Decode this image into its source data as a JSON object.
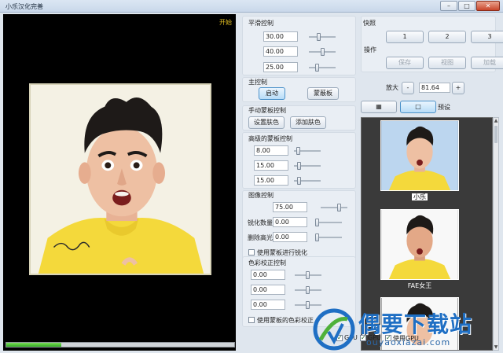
{
  "window": {
    "title": "小乐汉化完善",
    "min_label": "–",
    "max_label": "□",
    "close_label": "✕"
  },
  "viewer": {
    "start_label": "开始",
    "progress": 0.24
  },
  "smoothing": {
    "title": "平滑控制",
    "values": [
      "30.00",
      "40.00",
      "25.00"
    ],
    "slider_levels": [
      0.35,
      0.55,
      0.3
    ]
  },
  "main_control": {
    "title": "主控制",
    "start_label": "启动",
    "mask_label": "蒙蔽板"
  },
  "manual_mask": {
    "title": "手动蒙板控制",
    "set_color_label": "设置肤色",
    "add_color_label": "添加肤色"
  },
  "advanced_mask": {
    "title": "高级的蒙板控制",
    "values": [
      "8.00",
      "15.00",
      "15.00"
    ],
    "slider_levels": [
      0.1,
      0.15,
      0.15
    ]
  },
  "image_control": {
    "title": "图像控制",
    "row1_value": "75.00",
    "sharpen_label": "锐化数量",
    "sharpen_value": "0.00",
    "remove_highlight_label": "删除高光",
    "remove_highlight_value": "0.00",
    "use_mask_sharpen_label": "使用蒙板进行锐化",
    "slider_levels": [
      0.75,
      0.0,
      0.0
    ]
  },
  "color_correction": {
    "title": "色彩校正控制",
    "values": [
      "0.00",
      "0.00",
      "0.00"
    ],
    "slider_levels": [
      0.5,
      0.5,
      0.5
    ],
    "use_mask_label": "使用蒙板的色彩校正"
  },
  "snapshot": {
    "title": "快照",
    "buttons": [
      "1",
      "2",
      "3"
    ]
  },
  "operations": {
    "title": "操作",
    "save_label": "保存",
    "view_label": "视图",
    "load_label": "加载"
  },
  "zoom": {
    "label": "放大",
    "minus": "-",
    "value": "81.64",
    "plus": "+"
  },
  "view_mode": {
    "preset_label": "预设"
  },
  "presets": [
    {
      "label": "小乐"
    },
    {
      "label": "FAE女王"
    }
  ],
  "gpu": {
    "label1": "GPU",
    "label2": "GPU",
    "label3": "使用GPU"
  },
  "watermark": {
    "title": "偶要下载站",
    "url": "ouyaoxiazai.com"
  }
}
